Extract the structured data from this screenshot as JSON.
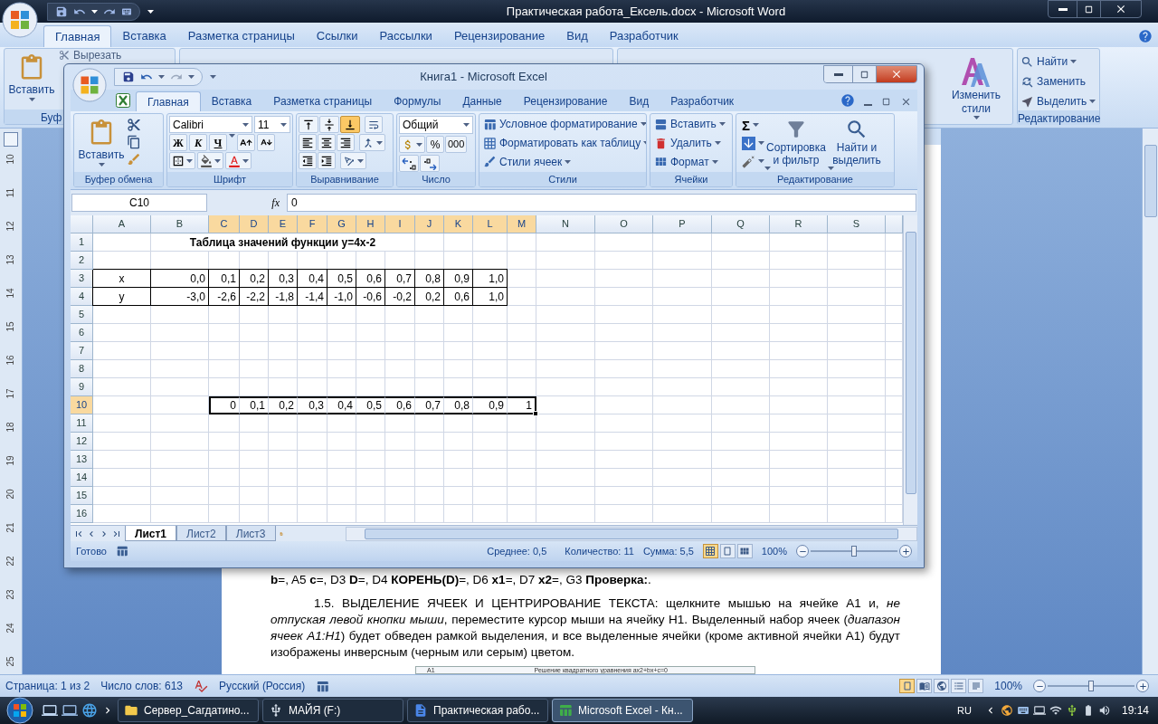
{
  "word": {
    "title": "Практическая работа_Ексель.docx - Microsoft Word",
    "tabs": [
      {
        "label": "Главная",
        "selected": true
      },
      {
        "label": "Вставка",
        "selected": false
      },
      {
        "label": "Разметка страницы",
        "selected": false
      },
      {
        "label": "Ссылки",
        "selected": false
      },
      {
        "label": "Рассылки",
        "selected": false
      },
      {
        "label": "Рецензирование",
        "selected": false
      },
      {
        "label": "Вид",
        "selected": false
      },
      {
        "label": "Разработчик",
        "selected": false
      }
    ],
    "ribbon": {
      "paste": "Вставить",
      "cut": "Вырезать",
      "clipboard_group": "Буф",
      "change_styles": "Изменить стили",
      "find": "Найти",
      "replace": "Заменить",
      "select": "Выделить",
      "editing_group": "Редактирование"
    },
    "vertical_ruler": [
      "10",
      "11",
      "12",
      "13",
      "14",
      "15",
      "16",
      "17",
      "18",
      "19",
      "20",
      "21",
      "22",
      "23",
      "24",
      "25"
    ],
    "document": {
      "paragraphs": [
        {
          "kind": "plain",
          "text": "**b**=, A5 **c**=, D3 **D**=, D4 **КОРЕНЬ(D)**=, D6 **x1**=, D7 **x2**=, G3 **Проверка:**."
        },
        {
          "kind": "indented",
          "text": "1.5. ВЫДЕЛЕНИЕ ЯЧЕЕК И ЦЕНТРИРОВАНИЕ ТЕКСТА: щелкните мышью на ячейке А1 и, *не отпуская левой кнопки мыши*, переместите курсор мыши на ячейку Н1. Выделенный набор ячеек (*диапазон ячеек А1:Н1*) будет обведен рамкой выделения, и все выделенные ячейки (кроме активной ячейки А1) будут изображены инверсным (черным или серым) цветом."
        }
      ],
      "figure": {
        "cell": "A1",
        "caption": "Решение квадратного уравнения ax2+bx+c=0"
      }
    },
    "status_bar": {
      "page": "Страница: 1 из 2",
      "words": "Число слов: 613",
      "language": "Русский (Россия)",
      "views": [
        {
          "kind": "print",
          "selected": true
        },
        {
          "kind": "reading",
          "selected": false
        },
        {
          "kind": "web",
          "selected": false
        },
        {
          "kind": "outline",
          "selected": false
        },
        {
          "kind": "draft",
          "selected": false
        }
      ],
      "zoom": "100%",
      "level": 0.5
    }
  },
  "excel": {
    "title": "Книга1 - Microsoft Excel",
    "tabs": [
      {
        "label": "Главная",
        "selected": true
      },
      {
        "label": "Вставка",
        "selected": false
      },
      {
        "label": "Разметка страницы",
        "selected": false
      },
      {
        "label": "Формулы",
        "selected": false
      },
      {
        "label": "Данные",
        "selected": false
      },
      {
        "label": "Рецензирование",
        "selected": false
      },
      {
        "label": "Вид",
        "selected": false
      },
      {
        "label": "Разработчик",
        "selected": false
      }
    ],
    "ribbon": {
      "clipboard": {
        "paste": "Вставить",
        "label": "Буфер обмена"
      },
      "font": {
        "name": "Calibri",
        "size": "11",
        "bold": "Ж",
        "italic": "К",
        "underline": "Ч",
        "label": "Шрифт"
      },
      "alignment": {
        "vertical": [
          {
            "kind": "top",
            "selected": false
          },
          {
            "kind": "middle",
            "selected": false
          },
          {
            "kind": "bottom",
            "selected": true
          }
        ],
        "label": "Выравнивание"
      },
      "number": {
        "format": "Общий",
        "percent": "%",
        "thousands": "000",
        "label": "Число"
      },
      "styles": {
        "items": [
          "Условное форматирование",
          "Форматировать как таблицу",
          "Стили ячеек"
        ],
        "label": "Стили"
      },
      "cells": {
        "items": [
          "Вставить",
          "Удалить",
          "Формат"
        ],
        "label": "Ячейки"
      },
      "editing": {
        "sum": "Σ",
        "sort": "Сортировка и фильтр",
        "find": "Найти и выделить",
        "label": "Редактирование"
      }
    },
    "formula_bar": {
      "name_box": "C10",
      "fx": "fx",
      "value": "0"
    },
    "grid": {
      "columns": [
        {
          "label": "A",
          "selected": false
        },
        {
          "label": "B",
          "selected": false
        },
        {
          "label": "C",
          "selected": true
        },
        {
          "label": "D",
          "selected": true
        },
        {
          "label": "E",
          "selected": true
        },
        {
          "label": "F",
          "selected": true
        },
        {
          "label": "G",
          "selected": true
        },
        {
          "label": "H",
          "selected": true
        },
        {
          "label": "I",
          "selected": true
        },
        {
          "label": "J",
          "selected": true
        },
        {
          "label": "K",
          "selected": true
        },
        {
          "label": "L",
          "selected": true
        },
        {
          "label": "M",
          "selected": true
        },
        {
          "label": "N",
          "selected": false
        },
        {
          "label": "O",
          "selected": false
        },
        {
          "label": "P",
          "selected": false
        },
        {
          "label": "Q",
          "selected": false
        },
        {
          "label": "R",
          "selected": false
        },
        {
          "label": "S",
          "selected": false
        }
      ],
      "rows": [
        {
          "label": "1",
          "selected": false,
          "kind": "title",
          "title": "Таблица значений функции y=4x-2"
        },
        {
          "label": "2",
          "selected": false,
          "kind": "empty"
        },
        {
          "label": "3",
          "selected": false,
          "kind": "table",
          "cells": [
            "x",
            "0,0",
            "0,1",
            "0,2",
            "0,3",
            "0,4",
            "0,5",
            "0,6",
            "0,7",
            "0,8",
            "0,9",
            "1,0"
          ]
        },
        {
          "label": "4",
          "selected": false,
          "kind": "table",
          "cells": [
            "y",
            "-3,0",
            "-2,6",
            "-2,2",
            "-1,8",
            "-1,4",
            "-1,0",
            "-0,6",
            "-0,2",
            "0,2",
            "0,6",
            "1,0"
          ]
        },
        {
          "label": "5",
          "selected": false,
          "kind": "empty"
        },
        {
          "label": "6",
          "selected": false,
          "kind": "empty"
        },
        {
          "label": "7",
          "selected": false,
          "kind": "empty"
        },
        {
          "label": "8",
          "selected": false,
          "kind": "empty"
        },
        {
          "label": "9",
          "selected": false,
          "kind": "empty"
        },
        {
          "label": "10",
          "selected": true,
          "kind": "selection",
          "cells": [
            null,
            null,
            "0",
            "0,1",
            "0,2",
            "0,3",
            "0,4",
            "0,5",
            "0,6",
            "0,7",
            "0,8",
            "0,9",
            "1"
          ]
        },
        {
          "label": "11",
          "selected": false,
          "kind": "empty"
        },
        {
          "label": "12",
          "selected": false,
          "kind": "empty"
        },
        {
          "label": "13",
          "selected": false,
          "kind": "empty"
        },
        {
          "label": "14",
          "selected": false,
          "kind": "empty"
        },
        {
          "label": "15",
          "selected": false,
          "kind": "empty"
        },
        {
          "label": "16",
          "selected": false,
          "kind": "empty"
        }
      ]
    },
    "sheet_tabs": [
      {
        "label": "Лист1",
        "selected": true
      },
      {
        "label": "Лист2",
        "selected": false
      },
      {
        "label": "Лист3",
        "selected": false
      }
    ],
    "status_bar": {
      "mode": "Готово",
      "average": "Среднее: 0,5",
      "count": "Количество: 11",
      "sum": "Сумма: 5,5",
      "views": [
        {
          "kind": "normal",
          "selected": true
        },
        {
          "kind": "layout",
          "selected": false
        },
        {
          "kind": "page_break",
          "selected": false
        }
      ],
      "zoom": "100%",
      "level": 0.5
    }
  },
  "taskbar": {
    "items": [
      {
        "label": "Сервер_Сагдатино...",
        "kind": "folder",
        "selected": false
      },
      {
        "label": "МАЙЯ (F:)",
        "kind": "drive",
        "selected": false
      },
      {
        "label": "Практическая рабо...",
        "kind": "word",
        "selected": false
      },
      {
        "label": "Microsoft Excel - Кн...",
        "kind": "excel",
        "selected": true
      }
    ],
    "language": "RU",
    "time": "19:14"
  }
}
